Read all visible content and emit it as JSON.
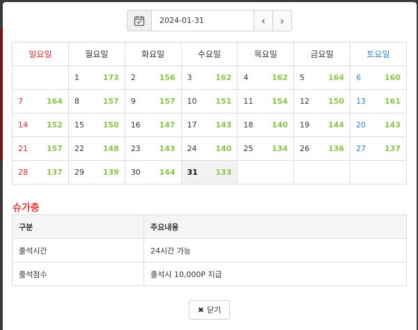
{
  "datepicker": {
    "value": "2024-01-31",
    "prev_label": "‹",
    "next_label": "›"
  },
  "calendar": {
    "weekdays": [
      "일요일",
      "월요일",
      "화요일",
      "수요일",
      "목요일",
      "금요일",
      "토요일"
    ],
    "weeks": [
      [
        null,
        {
          "day": "1",
          "count": "173"
        },
        {
          "day": "2",
          "count": "156"
        },
        {
          "day": "3",
          "count": "162"
        },
        {
          "day": "4",
          "count": "162"
        },
        {
          "day": "5",
          "count": "164"
        },
        {
          "day": "6",
          "count": "160"
        }
      ],
      [
        {
          "day": "7",
          "count": "164"
        },
        {
          "day": "8",
          "count": "157"
        },
        {
          "day": "9",
          "count": "157"
        },
        {
          "day": "10",
          "count": "151"
        },
        {
          "day": "11",
          "count": "154"
        },
        {
          "day": "12",
          "count": "150"
        },
        {
          "day": "13",
          "count": "161"
        }
      ],
      [
        {
          "day": "14",
          "count": "152"
        },
        {
          "day": "15",
          "count": "150"
        },
        {
          "day": "16",
          "count": "147"
        },
        {
          "day": "17",
          "count": "143"
        },
        {
          "day": "18",
          "count": "140"
        },
        {
          "day": "19",
          "count": "144"
        },
        {
          "day": "20",
          "count": "143"
        }
      ],
      [
        {
          "day": "21",
          "count": "157"
        },
        {
          "day": "22",
          "count": "148"
        },
        {
          "day": "23",
          "count": "143"
        },
        {
          "day": "24",
          "count": "140"
        },
        {
          "day": "25",
          "count": "134"
        },
        {
          "day": "26",
          "count": "136"
        },
        {
          "day": "27",
          "count": "137"
        }
      ],
      [
        {
          "day": "28",
          "count": "137"
        },
        {
          "day": "29",
          "count": "139"
        },
        {
          "day": "30",
          "count": "144"
        },
        {
          "day": "31",
          "count": "133",
          "today": true
        },
        null,
        null,
        null
      ]
    ]
  },
  "section": {
    "title": "슈가충"
  },
  "info_table": {
    "headers": [
      "구분",
      "주요내용"
    ],
    "rows": [
      [
        "출석시간",
        "24시간 가능"
      ],
      [
        "출석점수",
        "출석시 10,000P 지급"
      ]
    ]
  },
  "close_button": {
    "icon": "✖",
    "label": "닫기"
  },
  "colors": {
    "sunday": "#d9282f",
    "saturday": "#2a86c6",
    "count": "#8bc34a",
    "section_title": "#e53935"
  }
}
